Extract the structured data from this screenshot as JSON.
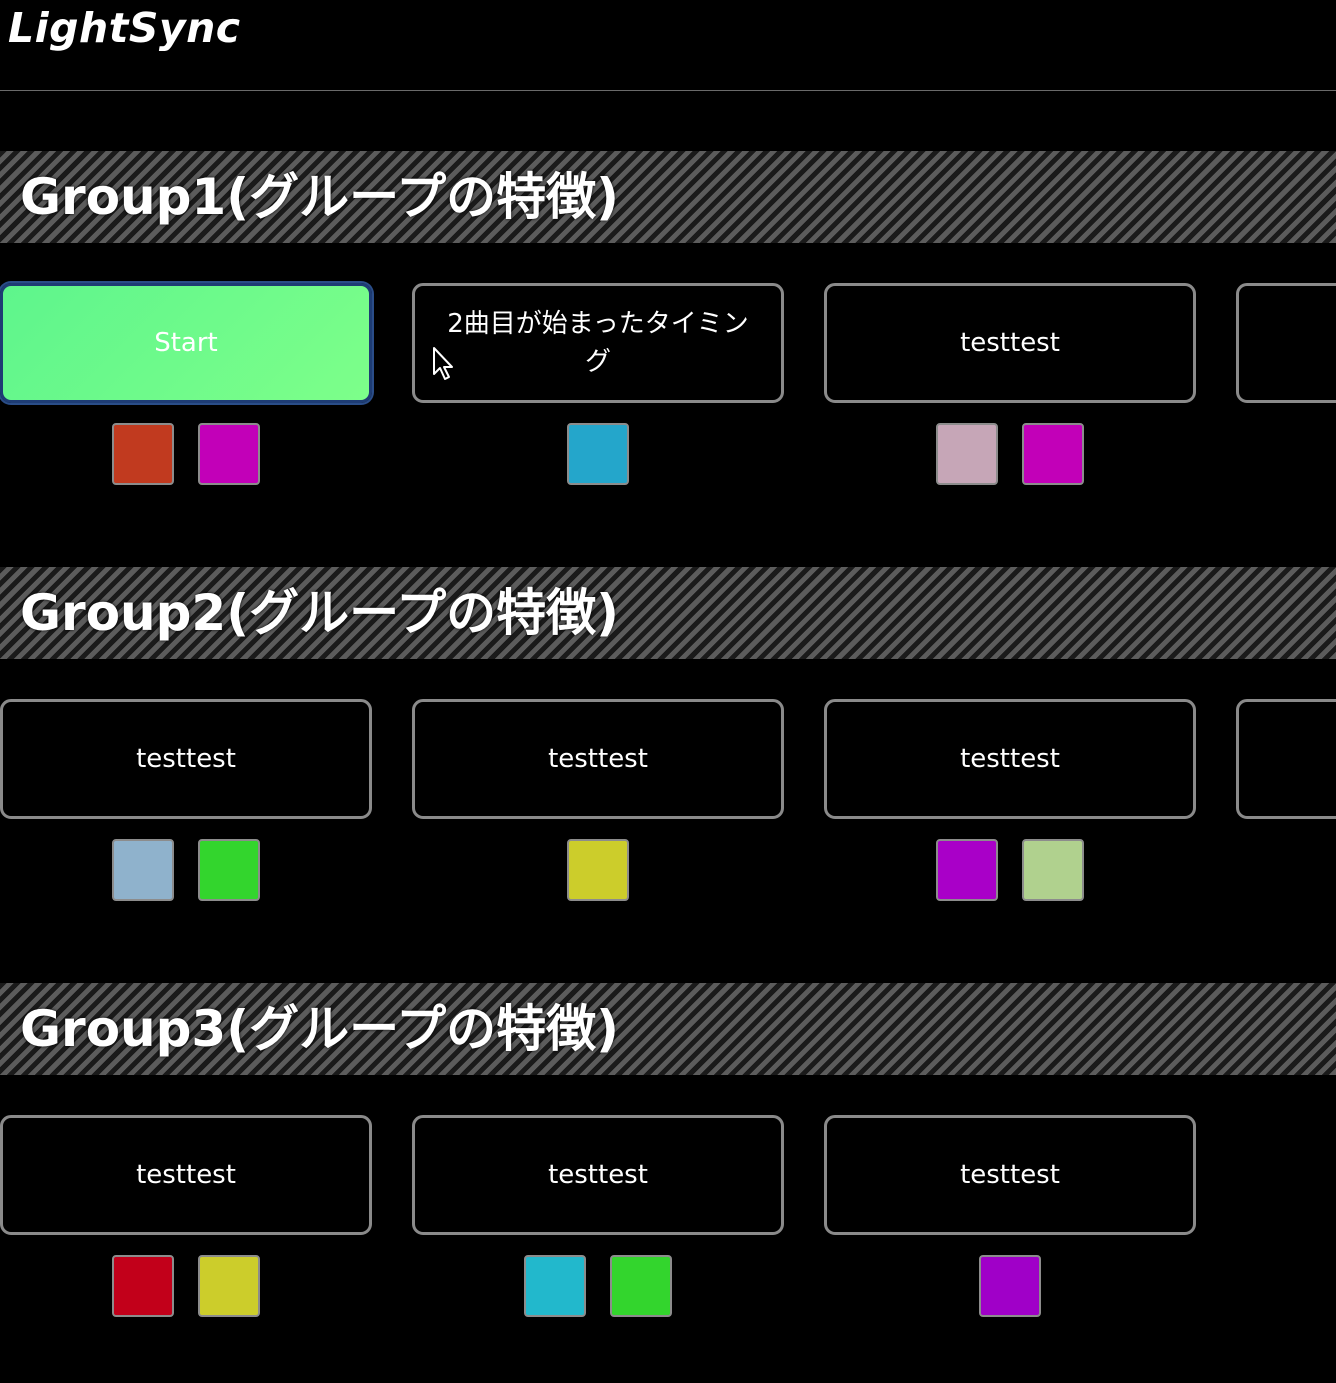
{
  "app": {
    "title": "LightSync"
  },
  "groups": [
    {
      "title": "Group1(グループの特徴)",
      "cues": [
        {
          "label": "Start",
          "active": true,
          "swatches": [
            "#c13a1f",
            "#c200b8"
          ]
        },
        {
          "label": "2曲目が始まったタイミング",
          "active": false,
          "swatches": [
            "#24a6cb"
          ]
        },
        {
          "label": "testtest",
          "active": false,
          "swatches": [
            "#c6a6b7",
            "#c200b8"
          ]
        },
        {
          "label": "",
          "active": false,
          "swatches": []
        }
      ]
    },
    {
      "title": "Group2(グループの特徴)",
      "cues": [
        {
          "label": "testtest",
          "active": false,
          "swatches": [
            "#8fb2cc",
            "#33d52d"
          ]
        },
        {
          "label": "testtest",
          "active": false,
          "swatches": [
            "#cccd2b"
          ]
        },
        {
          "label": "testtest",
          "active": false,
          "swatches": [
            "#a900c8",
            "#b0d18e"
          ]
        },
        {
          "label": "",
          "active": false,
          "swatches": []
        }
      ]
    },
    {
      "title": "Group3(グループの特徴)",
      "cues": [
        {
          "label": "testtest",
          "active": false,
          "swatches": [
            "#c2001a",
            "#cccd2b"
          ]
        },
        {
          "label": "testtest",
          "active": false,
          "swatches": [
            "#22b8cc",
            "#33d52d"
          ]
        },
        {
          "label": "testtest",
          "active": false,
          "swatches": [
            "#a000c8"
          ]
        }
      ]
    }
  ]
}
